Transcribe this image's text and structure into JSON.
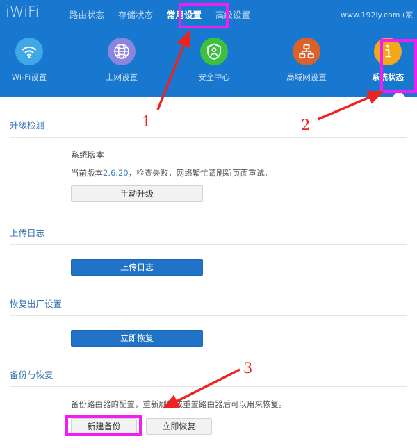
{
  "header": {
    "brand": "iWiFi",
    "url_text": "www.192ly.com (家",
    "nav_items": [
      {
        "label": "路由状态",
        "active": false
      },
      {
        "label": "存储状态",
        "active": false
      },
      {
        "label": "常用设置",
        "active": true
      },
      {
        "label": "高级设置",
        "active": false
      }
    ]
  },
  "icon_nav": [
    {
      "label": "Wi-Fi设置",
      "icon": "wifi-icon",
      "color": "#41a8e8",
      "active": false
    },
    {
      "label": "上网设置",
      "icon": "globe-icon",
      "color": "#8b85e0",
      "active": false
    },
    {
      "label": "安全中心",
      "icon": "shield-person-icon",
      "color": "#3ec03e",
      "active": false
    },
    {
      "label": "局域网设置",
      "icon": "network-tree-icon",
      "color": "#d9622b",
      "active": false
    },
    {
      "label": "系统状态",
      "icon": "info-icon",
      "color": "#f3a81c",
      "active": true
    }
  ],
  "sections": {
    "upgrade": {
      "title": "升级检测",
      "sub_title": "系统版本",
      "version_prefix": "当前版本",
      "version_number": "2.6.20",
      "version_suffix": "，检查失败，网络繁忙请刷新页面重试。",
      "manual_upgrade_label": "手动升级"
    },
    "upload_log": {
      "title": "上传日志",
      "button_label": "上传日志"
    },
    "factory_reset": {
      "title": "恢复出厂设置",
      "button_label": "立即恢复"
    },
    "backup_restore": {
      "title": "备份与恢复",
      "description": "备份路由器的配置，重新刷机或重置路由器后可以用来恢复。",
      "new_backup_label": "新建备份",
      "restore_now_label": "立即恢复"
    }
  },
  "annotations": {
    "highlight_color": "#f21df2",
    "arrow_color": "#ef2222",
    "steps": [
      {
        "number": "1",
        "target": "常用设置"
      },
      {
        "number": "2",
        "target": "系统状态"
      },
      {
        "number": "3",
        "target": "新建备份"
      }
    ]
  }
}
